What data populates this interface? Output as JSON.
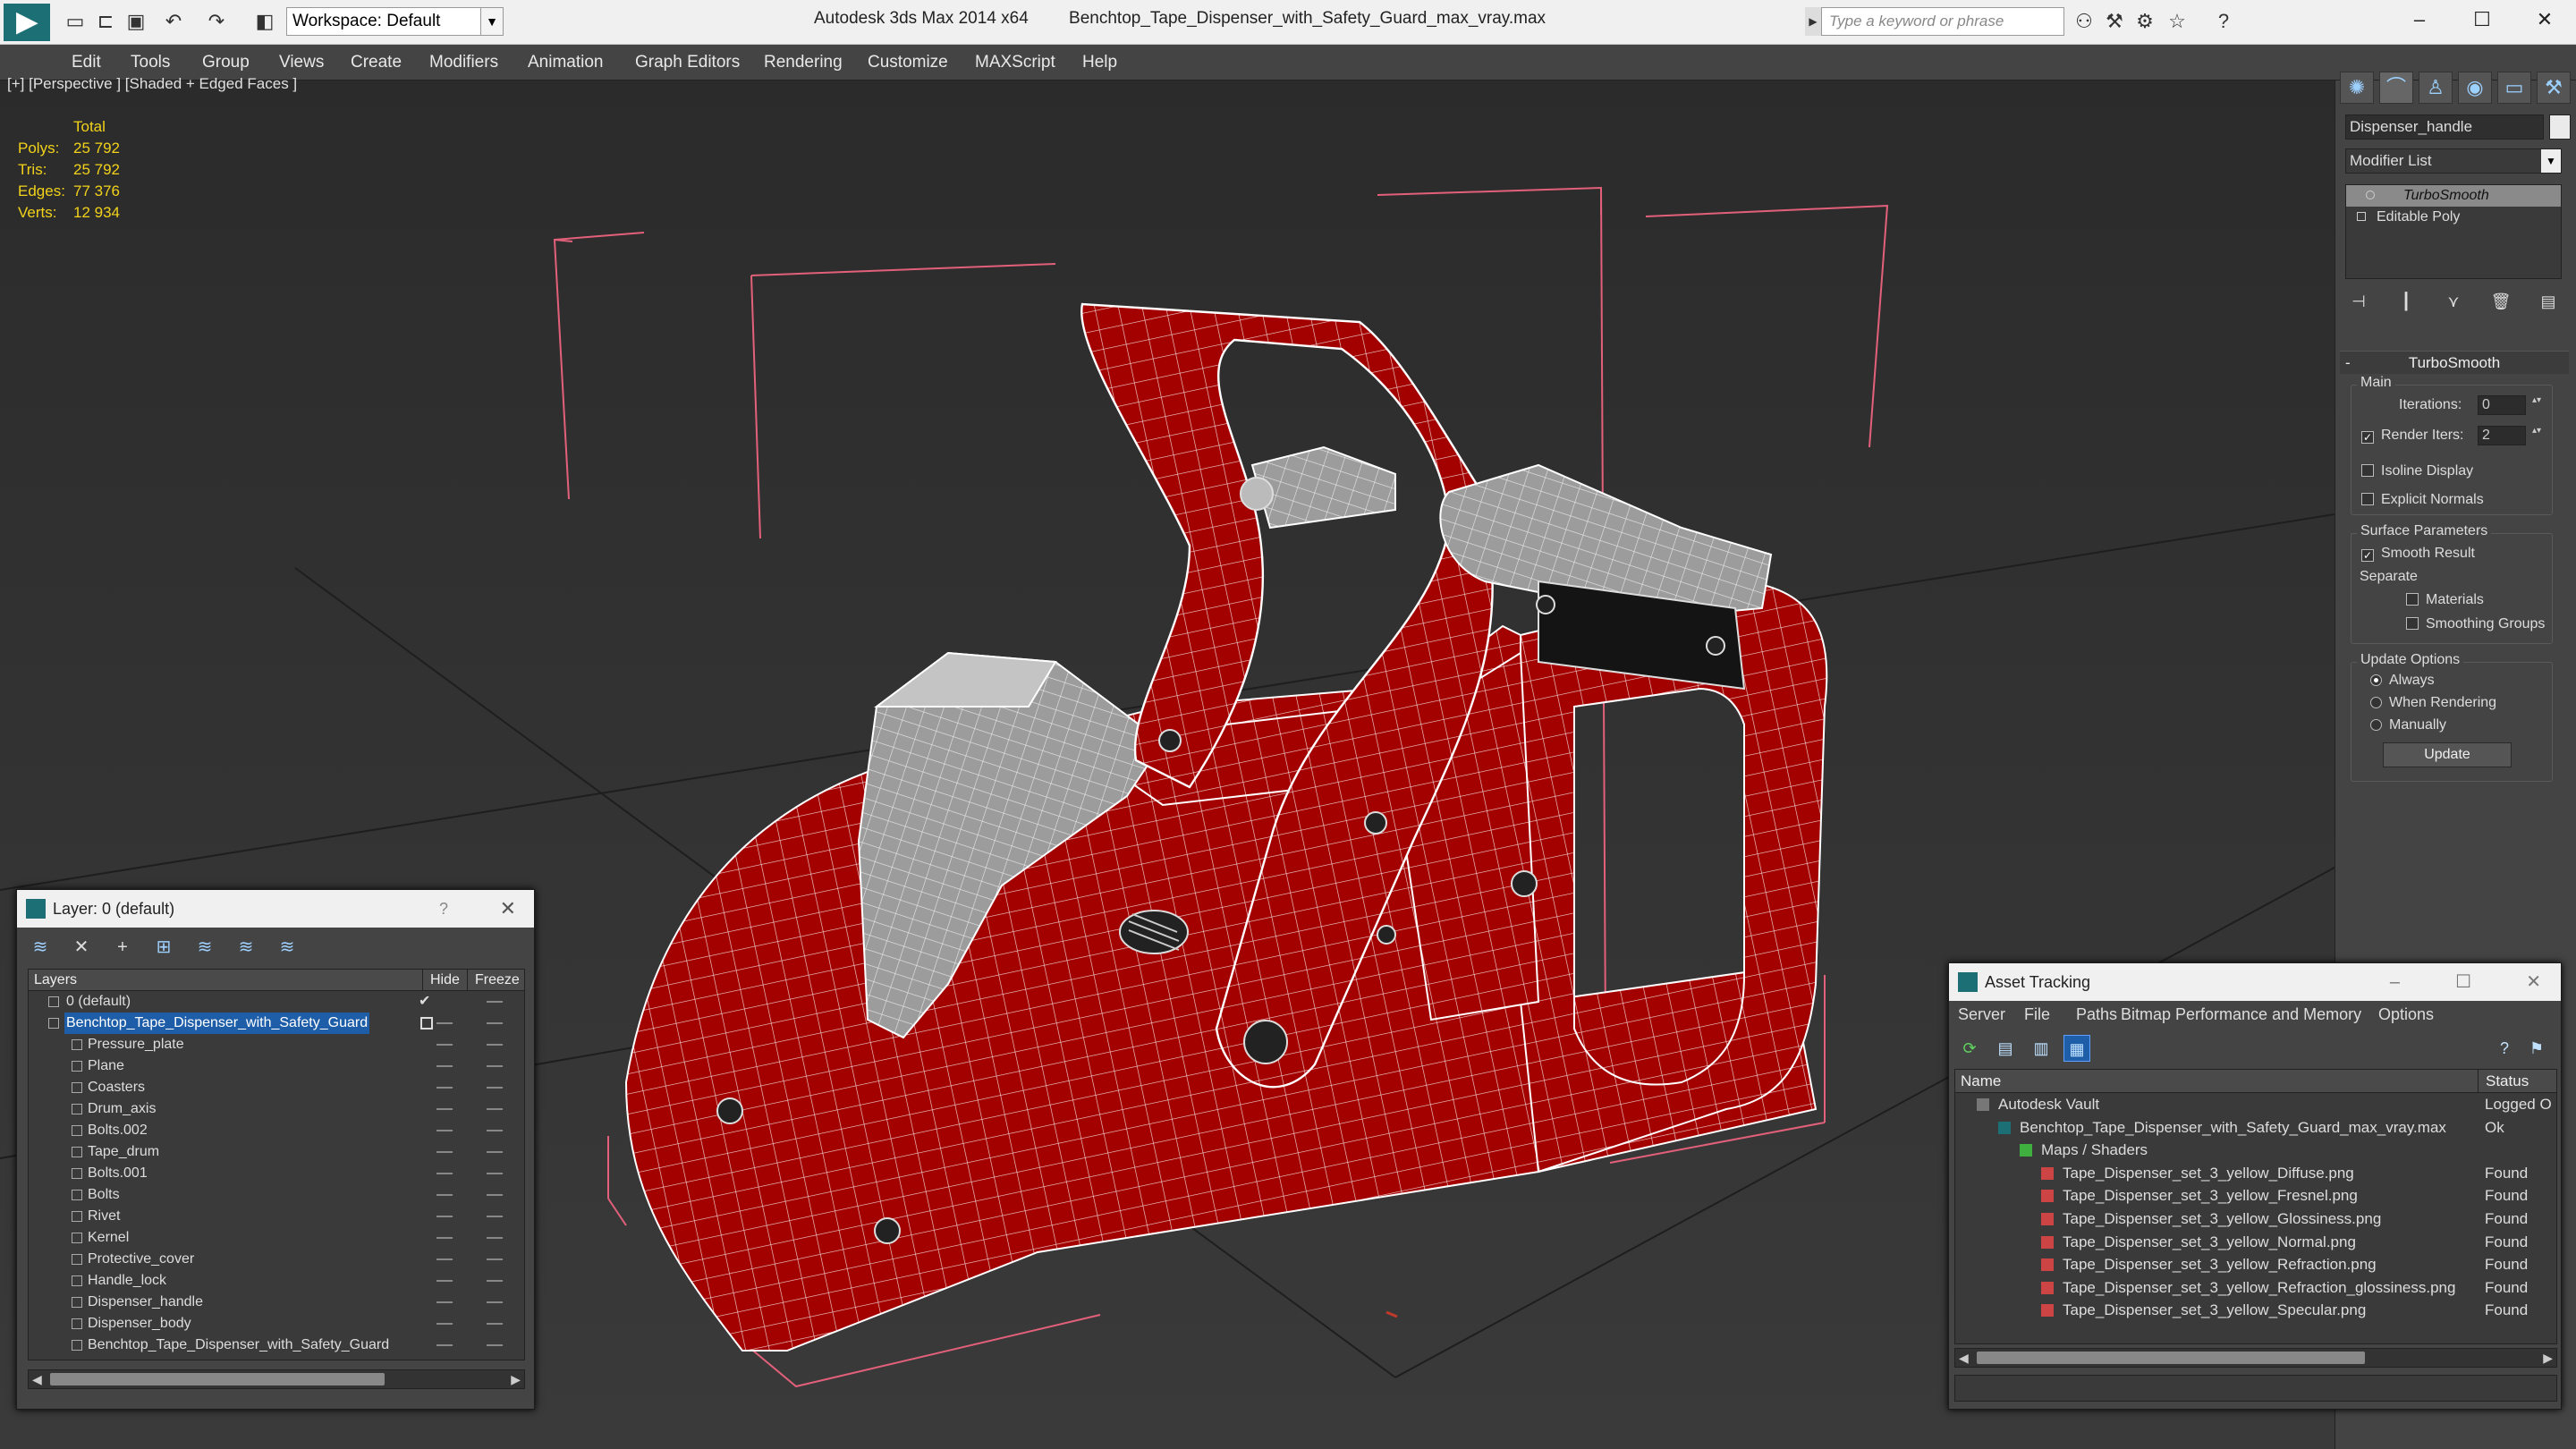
{
  "window": {
    "app_title": "Autodesk 3ds Max  2014 x64",
    "file_title": "Benchtop_Tape_Dispenser_with_Safety_Guard_max_vray.max",
    "workspace": "Workspace: Default",
    "search_placeholder": "Type a keyword or phrase"
  },
  "menu": [
    "Edit",
    "Tools",
    "Group",
    "Views",
    "Create",
    "Modifiers",
    "Animation",
    "Graph Editors",
    "Rendering",
    "Customize",
    "MAXScript",
    "Help"
  ],
  "viewport": {
    "label": "[+] [Perspective ] [Shaded + Edged Faces ]",
    "stats": {
      "header": "Total",
      "rows": [
        {
          "k": "Polys:",
          "v": "25 792"
        },
        {
          "k": "Tris:",
          "v": "25 792"
        },
        {
          "k": "Edges:",
          "v": "77 376"
        },
        {
          "k": "Verts:",
          "v": "12 934"
        }
      ]
    },
    "colors": {
      "model_red": "#a30000",
      "wire": "#ffffff",
      "parts_grey": "#9a9a9a",
      "bbox_pink": "#e3607a"
    }
  },
  "command_panel": {
    "object_name": "Dispenser_handle",
    "modifier_list": "Modifier List",
    "stack": [
      "TurboSmooth",
      "Editable Poly"
    ],
    "rollout_title": "TurboSmooth",
    "main_group": "Main",
    "iterations_label": "Iterations:",
    "iterations_value": "0",
    "render_iters_label": "Render Iters:",
    "render_iters_value": "2",
    "isoline": "Isoline Display",
    "explicit_normals": "Explicit Normals",
    "surface_group": "Surface Parameters",
    "smooth_result": "Smooth Result",
    "separate": "Separate",
    "materials": "Materials",
    "smoothing_groups": "Smoothing Groups",
    "update_group": "Update Options",
    "always": "Always",
    "when_rendering": "When Rendering",
    "manually": "Manually",
    "update_button": "Update"
  },
  "layer_window": {
    "title": "Layer: 0 (default)",
    "help": "?",
    "columns": {
      "layers": "Layers",
      "hide": "Hide",
      "freeze": "Freeze"
    },
    "rows": [
      {
        "name": "0 (default)",
        "type": "layer"
      },
      {
        "name": "Benchtop_Tape_Dispenser_with_Safety_Guard",
        "type": "layer-selected"
      },
      {
        "name": "Pressure_plate",
        "type": "child"
      },
      {
        "name": "Plane",
        "type": "child"
      },
      {
        "name": "Coasters",
        "type": "child"
      },
      {
        "name": "Drum_axis",
        "type": "child"
      },
      {
        "name": "Bolts.002",
        "type": "child"
      },
      {
        "name": "Tape_drum",
        "type": "child"
      },
      {
        "name": "Bolts.001",
        "type": "child"
      },
      {
        "name": "Bolts",
        "type": "child"
      },
      {
        "name": "Rivet",
        "type": "child"
      },
      {
        "name": "Kernel",
        "type": "child"
      },
      {
        "name": "Protective_cover",
        "type": "child"
      },
      {
        "name": "Handle_lock",
        "type": "child"
      },
      {
        "name": "Dispenser_handle",
        "type": "child"
      },
      {
        "name": "Dispenser_body",
        "type": "child"
      },
      {
        "name": "Benchtop_Tape_Dispenser_with_Safety_Guard",
        "type": "child"
      }
    ]
  },
  "asset_window": {
    "title": "Asset Tracking",
    "menu": [
      "Server",
      "File",
      "Paths",
      "Bitmap Performance and Memory",
      "Options"
    ],
    "columns": {
      "name": "Name",
      "status": "Status"
    },
    "rows": [
      {
        "name": "Autodesk Vault",
        "status": "Logged O",
        "level": 0
      },
      {
        "name": "Benchtop_Tape_Dispenser_with_Safety_Guard_max_vray.max",
        "status": "Ok",
        "level": 1
      },
      {
        "name": "Maps / Shaders",
        "status": "",
        "level": 2
      },
      {
        "name": "Tape_Dispenser_set_3_yellow_Diffuse.png",
        "status": "Found",
        "level": 3
      },
      {
        "name": "Tape_Dispenser_set_3_yellow_Fresnel.png",
        "status": "Found",
        "level": 3
      },
      {
        "name": "Tape_Dispenser_set_3_yellow_Glossiness.png",
        "status": "Found",
        "level": 3
      },
      {
        "name": "Tape_Dispenser_set_3_yellow_Normal.png",
        "status": "Found",
        "level": 3
      },
      {
        "name": "Tape_Dispenser_set_3_yellow_Refraction.png",
        "status": "Found",
        "level": 3
      },
      {
        "name": "Tape_Dispenser_set_3_yellow_Refraction_glossiness.png",
        "status": "Found",
        "level": 3
      },
      {
        "name": "Tape_Dispenser_set_3_yellow_Specular.png",
        "status": "Found",
        "level": 3
      }
    ]
  }
}
